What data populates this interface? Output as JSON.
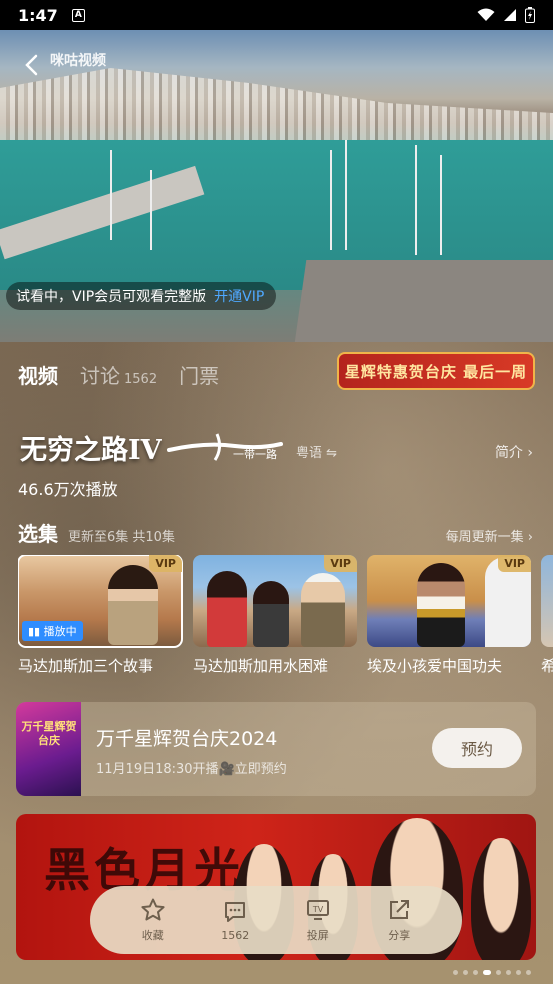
{
  "status_bar": {
    "time": "1:47",
    "indicator": "A"
  },
  "video": {
    "logo_text": "咪咕视频",
    "trial_text": "试看中，VIP会员可观看完整版",
    "trial_link": "开通VIP"
  },
  "tabs": [
    {
      "label": "视频",
      "count": ""
    },
    {
      "label": "讨论",
      "count": "1562"
    },
    {
      "label": "门票",
      "count": ""
    }
  ],
  "promo": {
    "label": "星辉特惠贺台庆  最后一周"
  },
  "show": {
    "title": "无穷之路IV",
    "brush_text": "一带一路",
    "lang": "粤语",
    "intro": "简介",
    "plays": "46.6万次播放"
  },
  "episodes_section": {
    "title": "选集",
    "subtitle": "更新至6集 共10集",
    "more": "每周更新一集",
    "items": [
      {
        "label": "马达加斯加三个故事",
        "vip": "VIP",
        "playing": "播放中"
      },
      {
        "label": "马达加斯加用水困难",
        "vip": "VIP"
      },
      {
        "label": "埃及小孩爱中国功夫",
        "vip": "VIP"
      },
      {
        "label": "希"
      }
    ]
  },
  "live_card": {
    "title": "万千星辉贺台庆2024",
    "subtitle": "11月19日18:30开播🎥立即预约",
    "button": "预约",
    "poster_text": "万千星辉贺台庆"
  },
  "banner": {
    "title": "黑色月光"
  },
  "actions": [
    {
      "label": "收藏",
      "icon": "star-icon"
    },
    {
      "label": "1562",
      "icon": "comment-icon"
    },
    {
      "label": "投屏",
      "icon": "cast-icon"
    },
    {
      "label": "分享",
      "icon": "share-icon"
    }
  ],
  "colors": {
    "accent_blue": "#2f8dff",
    "vip_gold": "#dcb464",
    "promo_red": "#c8301f",
    "panel_brown": "#8e7b63"
  }
}
